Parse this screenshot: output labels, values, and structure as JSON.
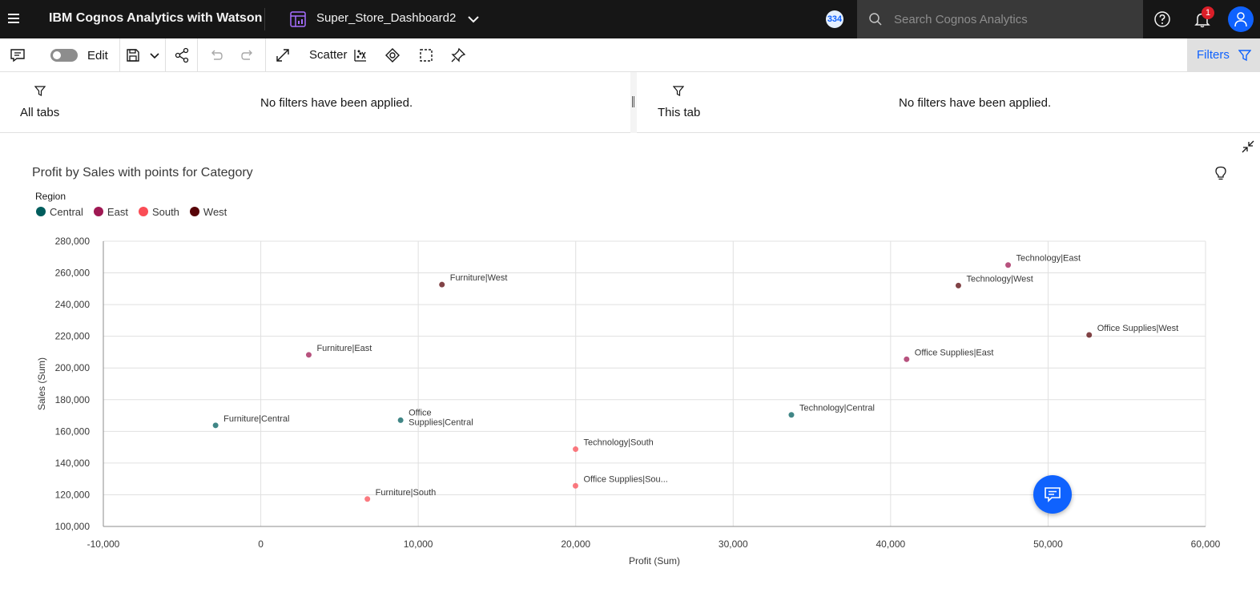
{
  "topbar": {
    "app_title": "IBM Cognos Analytics with Watson",
    "dashboard_name": "Super_Store_Dashboard2",
    "badge_count": "334",
    "search_placeholder": "Search Cognos Analytics",
    "notification_count": "1"
  },
  "toolbar": {
    "edit_label": "Edit",
    "visualization_label": "Scatter",
    "filters_label": "Filters"
  },
  "filters": {
    "all_tabs": {
      "label": "All tabs",
      "message": "No filters have been applied."
    },
    "this_tab": {
      "label": "This tab",
      "message": "No filters have been applied."
    }
  },
  "colors": {
    "accent": "#0f62fe",
    "topbar": "#161616",
    "central": "#005d5d",
    "east": "#9f1853",
    "south": "#fa4d56",
    "west": "#570408"
  },
  "chart_data": {
    "type": "scatter",
    "title": "Profit by Sales with points for Category",
    "legend_title": "Region",
    "legend_placement": "top-left",
    "xlabel": "Profit (Sum)",
    "ylabel": "Sales (Sum)",
    "xlim": [
      -10000,
      60000
    ],
    "ylim": [
      100000,
      280000
    ],
    "x_ticks": [
      -10000,
      0,
      10000,
      20000,
      30000,
      40000,
      50000,
      60000
    ],
    "x_tick_labels": [
      "-10,000",
      "0",
      "10,000",
      "20,000",
      "30,000",
      "40,000",
      "50,000",
      "60,000"
    ],
    "y_ticks": [
      100000,
      120000,
      140000,
      160000,
      180000,
      200000,
      220000,
      240000,
      260000,
      280000
    ],
    "y_tick_labels": [
      "100,000",
      "120,000",
      "140,000",
      "160,000",
      "180,000",
      "200,000",
      "220,000",
      "240,000",
      "260,000",
      "280,000"
    ],
    "grid": true,
    "series": [
      {
        "name": "Central",
        "color": "#005d5d",
        "points": [
          {
            "label": "Furniture|Central",
            "x": -2871,
            "y": 163797
          },
          {
            "label": "Office Supplies|Central",
            "x": 8880,
            "y": 167026
          },
          {
            "label": "Technology|Central",
            "x": 33698,
            "y": 170417
          }
        ]
      },
      {
        "name": "East",
        "color": "#9f1853",
        "points": [
          {
            "label": "Furniture|East",
            "x": 3047,
            "y": 208291
          },
          {
            "label": "Office Supplies|East",
            "x": 41015,
            "y": 205516
          },
          {
            "label": "Technology|East",
            "x": 47463,
            "y": 264974
          }
        ]
      },
      {
        "name": "South",
        "color": "#fa4d56",
        "points": [
          {
            "label": "Furniture|South",
            "x": 6771,
            "y": 117299
          },
          {
            "label": "Office Supplies|South",
            "x": 19987,
            "y": 125652
          },
          {
            "label": "Technology|South",
            "x": 19992,
            "y": 148772
          }
        ]
      },
      {
        "name": "West",
        "color": "#570408",
        "points": [
          {
            "label": "Furniture|West",
            "x": 11505,
            "y": 252613
          },
          {
            "label": "Office Supplies|West",
            "x": 52610,
            "y": 220853
          },
          {
            "label": "Technology|West",
            "x": 44304,
            "y": 251992
          }
        ]
      }
    ]
  }
}
